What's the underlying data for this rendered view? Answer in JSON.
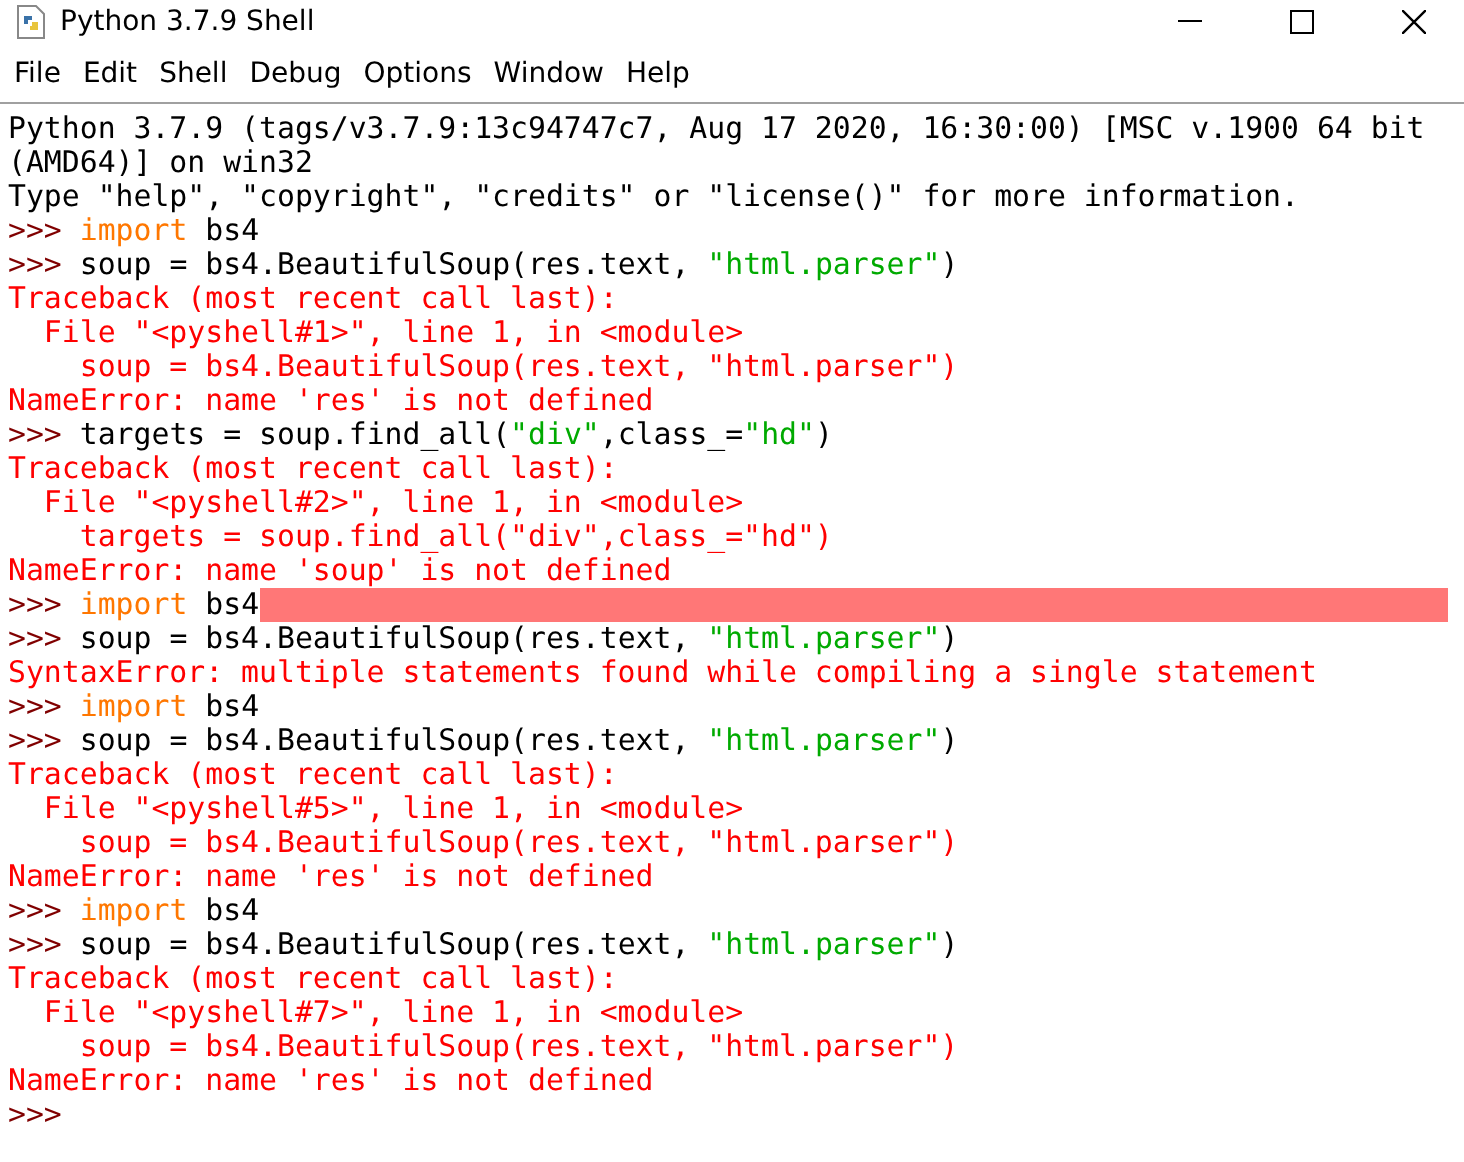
{
  "window": {
    "title": "Python 3.7.9 Shell"
  },
  "menu": [
    "File",
    "Edit",
    "Shell",
    "Debug",
    "Options",
    "Window",
    "Help"
  ],
  "lines": [
    {
      "highlighted": false,
      "segments": [
        {
          "kind": "output",
          "text": "Python 3.7.9 (tags/v3.7.9:13c94747c7, Aug 17 2020, 16:30:00) [MSC v.1900 64 bit"
        }
      ]
    },
    {
      "highlighted": false,
      "segments": [
        {
          "kind": "output",
          "text": "(AMD64)] on win32"
        }
      ]
    },
    {
      "highlighted": false,
      "segments": [
        {
          "kind": "output",
          "text": "Type \"help\", \"copyright\", \"credits\" or \"license()\" for more information."
        }
      ]
    },
    {
      "highlighted": false,
      "segments": [
        {
          "kind": "prompt",
          "text": ">>> "
        },
        {
          "kind": "keyword",
          "text": "import"
        },
        {
          "kind": "code",
          "text": " bs4"
        }
      ]
    },
    {
      "highlighted": false,
      "segments": [
        {
          "kind": "prompt",
          "text": ">>> "
        },
        {
          "kind": "code",
          "text": "soup = bs4.BeautifulSoup(res.text, "
        },
        {
          "kind": "string",
          "text": "\"html.parser\""
        },
        {
          "kind": "code",
          "text": ")"
        }
      ]
    },
    {
      "highlighted": false,
      "segments": [
        {
          "kind": "error",
          "text": "Traceback (most recent call last):"
        }
      ]
    },
    {
      "highlighted": false,
      "segments": [
        {
          "kind": "error",
          "text": "  File \"<pyshell#1>\", line 1, in <module>"
        }
      ]
    },
    {
      "highlighted": false,
      "segments": [
        {
          "kind": "error",
          "text": "    soup = bs4.BeautifulSoup(res.text, \"html.parser\")"
        }
      ]
    },
    {
      "highlighted": false,
      "segments": [
        {
          "kind": "error",
          "text": "NameError: name 'res' is not defined"
        }
      ]
    },
    {
      "highlighted": false,
      "segments": [
        {
          "kind": "prompt",
          "text": ">>> "
        },
        {
          "kind": "code",
          "text": "targets = soup.find_all("
        },
        {
          "kind": "string",
          "text": "\"div\""
        },
        {
          "kind": "code",
          "text": ",class_="
        },
        {
          "kind": "string",
          "text": "\"hd\""
        },
        {
          "kind": "code",
          "text": ")"
        }
      ]
    },
    {
      "highlighted": false,
      "segments": [
        {
          "kind": "error",
          "text": "Traceback (most recent call last):"
        }
      ]
    },
    {
      "highlighted": false,
      "segments": [
        {
          "kind": "error",
          "text": "  File \"<pyshell#2>\", line 1, in <module>"
        }
      ]
    },
    {
      "highlighted": false,
      "segments": [
        {
          "kind": "error",
          "text": "    targets = soup.find_all(\"div\",class_=\"hd\")"
        }
      ]
    },
    {
      "highlighted": false,
      "segments": [
        {
          "kind": "error",
          "text": "NameError: name 'soup' is not defined"
        }
      ]
    },
    {
      "highlighted": true,
      "segments": [
        {
          "kind": "prompt",
          "text": ">>> "
        },
        {
          "kind": "keyword",
          "text": "import"
        },
        {
          "kind": "code",
          "text": " bs4"
        }
      ]
    },
    {
      "highlighted": false,
      "segments": [
        {
          "kind": "prompt",
          "text": ">>> "
        },
        {
          "kind": "code",
          "text": "soup = bs4.BeautifulSoup(res.text, "
        },
        {
          "kind": "string",
          "text": "\"html.parser\""
        },
        {
          "kind": "code",
          "text": ")"
        }
      ]
    },
    {
      "highlighted": false,
      "segments": [
        {
          "kind": "error",
          "text": "SyntaxError: multiple statements found while compiling a single statement"
        }
      ]
    },
    {
      "highlighted": false,
      "segments": [
        {
          "kind": "prompt",
          "text": ">>> "
        },
        {
          "kind": "keyword",
          "text": "import"
        },
        {
          "kind": "code",
          "text": " bs4"
        }
      ]
    },
    {
      "highlighted": false,
      "segments": [
        {
          "kind": "prompt",
          "text": ">>> "
        },
        {
          "kind": "code",
          "text": "soup = bs4.BeautifulSoup(res.text, "
        },
        {
          "kind": "string",
          "text": "\"html.parser\""
        },
        {
          "kind": "code",
          "text": ")"
        }
      ]
    },
    {
      "highlighted": false,
      "segments": [
        {
          "kind": "error",
          "text": "Traceback (most recent call last):"
        }
      ]
    },
    {
      "highlighted": false,
      "segments": [
        {
          "kind": "error",
          "text": "  File \"<pyshell#5>\", line 1, in <module>"
        }
      ]
    },
    {
      "highlighted": false,
      "segments": [
        {
          "kind": "error",
          "text": "    soup = bs4.BeautifulSoup(res.text, \"html.parser\")"
        }
      ]
    },
    {
      "highlighted": false,
      "segments": [
        {
          "kind": "error",
          "text": "NameError: name 'res' is not defined"
        }
      ]
    },
    {
      "highlighted": false,
      "segments": [
        {
          "kind": "prompt",
          "text": ">>> "
        },
        {
          "kind": "keyword",
          "text": "import"
        },
        {
          "kind": "code",
          "text": " bs4"
        }
      ]
    },
    {
      "highlighted": false,
      "segments": [
        {
          "kind": "prompt",
          "text": ">>> "
        },
        {
          "kind": "code",
          "text": "soup = bs4.BeautifulSoup(res.text, "
        },
        {
          "kind": "string",
          "text": "\"html.parser\""
        },
        {
          "kind": "code",
          "text": ")"
        }
      ]
    },
    {
      "highlighted": false,
      "segments": [
        {
          "kind": "error",
          "text": "Traceback (most recent call last):"
        }
      ]
    },
    {
      "highlighted": false,
      "segments": [
        {
          "kind": "error",
          "text": "  File \"<pyshell#7>\", line 1, in <module>"
        }
      ]
    },
    {
      "highlighted": false,
      "segments": [
        {
          "kind": "error",
          "text": "    soup = bs4.BeautifulSoup(res.text, \"html.parser\")"
        }
      ]
    },
    {
      "highlighted": false,
      "segments": [
        {
          "kind": "error",
          "text": "NameError: name 'res' is not defined"
        }
      ]
    },
    {
      "highlighted": false,
      "segments": [
        {
          "kind": "prompt",
          "text": ">>>"
        }
      ]
    }
  ]
}
